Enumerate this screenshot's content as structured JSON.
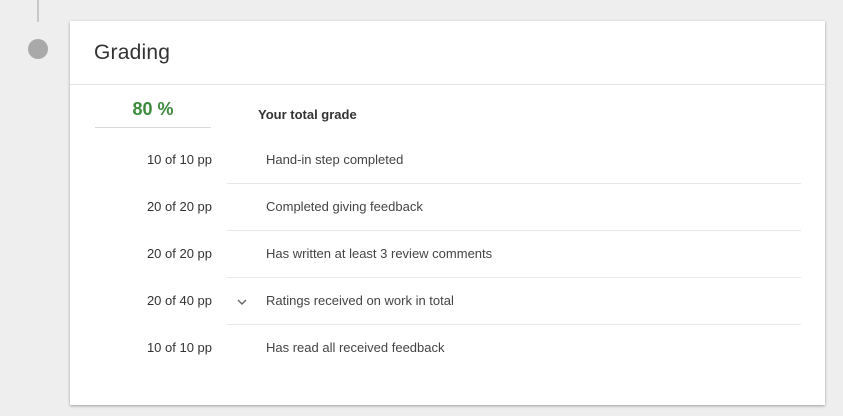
{
  "section": {
    "title": "Grading"
  },
  "total": {
    "percent": "80 %",
    "label": "Your total grade",
    "color": "#3d8b3d"
  },
  "criteria": [
    {
      "points": "10 of 10 pp",
      "label": "Hand-in step completed",
      "expandable": false
    },
    {
      "points": "20 of 20 pp",
      "label": "Completed giving feedback",
      "expandable": false
    },
    {
      "points": "20 of 20 pp",
      "label": "Has written at least 3 review comments",
      "expandable": false
    },
    {
      "points": "20 of 40 pp",
      "label": "Ratings received on work in total",
      "expandable": true,
      "icon": "chevron-down-icon"
    },
    {
      "points": "10 of 10 pp",
      "label": "Has read all received feedback",
      "expandable": false
    }
  ]
}
